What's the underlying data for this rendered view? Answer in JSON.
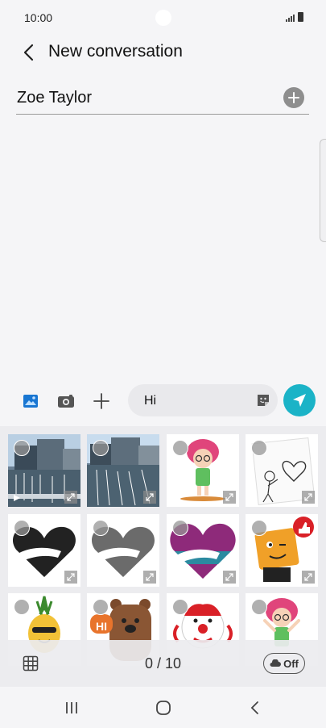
{
  "status": {
    "time": "10:00"
  },
  "header": {
    "title": "New conversation",
    "back_icon": "chevron-left-icon"
  },
  "recipient": {
    "name": "Zoe Taylor",
    "add_icon": "plus-circle-icon"
  },
  "composer": {
    "tools": [
      "gallery-icon",
      "camera-icon",
      "plus-icon"
    ],
    "message_text": "Hi",
    "sticker_icon": "sticker-icon",
    "send_icon": "send-icon",
    "send_color": "#1bb3c7"
  },
  "gallery": {
    "items": [
      {
        "kind": "photo",
        "icon": "video-thumbnail",
        "has_play": true
      },
      {
        "kind": "photo",
        "icon": "photo-thumbnail",
        "has_play": false
      },
      {
        "kind": "sticker",
        "icon": "girl-sticker"
      },
      {
        "kind": "sticker",
        "icon": "heart-drawing-sticker"
      },
      {
        "kind": "sticker",
        "icon": "heart-hug-black-sticker"
      },
      {
        "kind": "sticker",
        "icon": "heart-hug-grey-sticker"
      },
      {
        "kind": "sticker",
        "icon": "heart-hug-color-sticker"
      },
      {
        "kind": "sticker",
        "icon": "orange-thumbs-up-sticker"
      },
      {
        "kind": "sticker",
        "icon": "pineapple-sticker"
      },
      {
        "kind": "sticker",
        "icon": "bear-hi-sticker",
        "badge": "HI"
      },
      {
        "kind": "sticker",
        "icon": "clown-sticker"
      },
      {
        "kind": "sticker",
        "icon": "girl-waving-sticker"
      }
    ],
    "counter": "0 / 10",
    "toggle_label": "Off"
  },
  "navbar": {
    "items": [
      "recents-icon",
      "home-icon",
      "back-icon"
    ]
  }
}
